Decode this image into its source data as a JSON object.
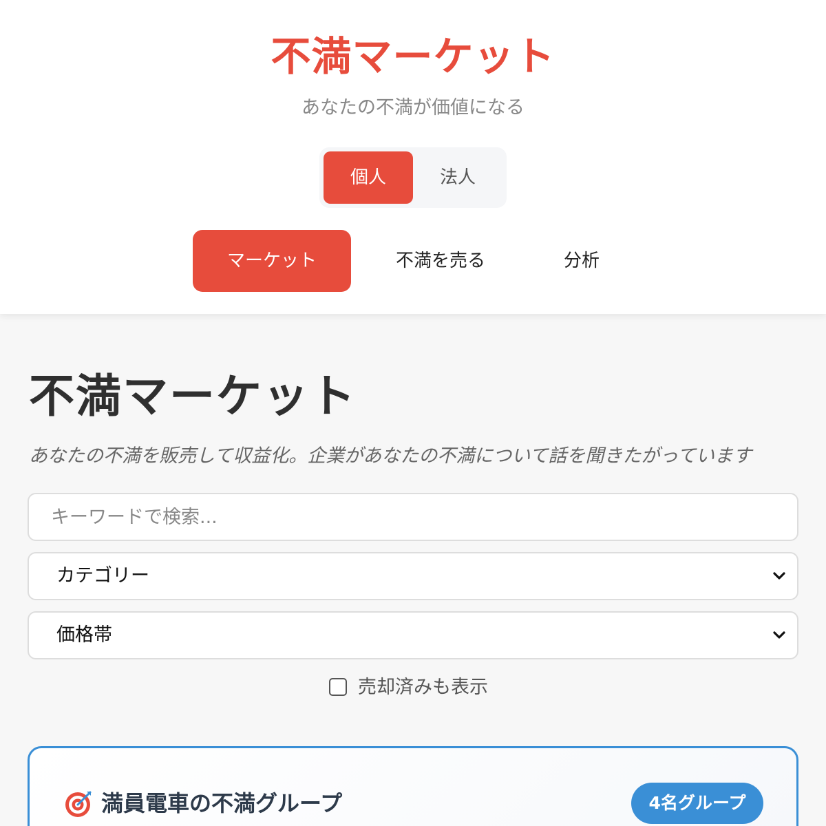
{
  "header": {
    "app_title": "不満マーケット",
    "tagline": "あなたの不満が価値になる",
    "mode_toggle": [
      {
        "label": "個人",
        "active": true
      },
      {
        "label": "法人",
        "active": false
      }
    ],
    "nav_tabs": [
      {
        "label": "マーケット",
        "active": true
      },
      {
        "label": "不満を売る",
        "active": false
      },
      {
        "label": "分析",
        "active": false
      }
    ]
  },
  "main": {
    "heading": "不満マーケット",
    "description": "あなたの不満を販売して収益化。企業があなたの不満について話を聞きたがっています",
    "search": {
      "placeholder": "キーワードで検索...",
      "value": ""
    },
    "category_select": {
      "selected": "カテゴリー",
      "icon": "chevron-down-icon"
    },
    "price_select": {
      "selected": "価格帯",
      "icon": "chevron-down-icon"
    },
    "show_sold": {
      "label": "売却済みも表示",
      "checked": false
    }
  },
  "group_card": {
    "icon": "target-icon",
    "title": "満員電車の不満グループ",
    "badge": "4名グループ",
    "border_color": "#3a8fd6"
  },
  "colors": {
    "accent": "#e74c3c",
    "info": "#3a8fd6",
    "background": "#f7f7f7"
  }
}
